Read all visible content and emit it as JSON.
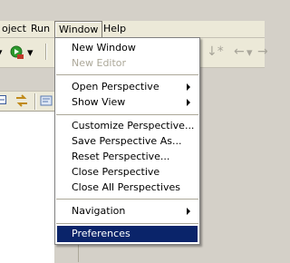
{
  "menubar": {
    "items": [
      {
        "label": "oject"
      },
      {
        "label": "Run"
      },
      {
        "label": "Window"
      },
      {
        "label": "Help"
      }
    ]
  },
  "window_menu": {
    "items": [
      {
        "label": "New Window",
        "enabled": true,
        "submenu": false
      },
      {
        "label": "New Editor",
        "enabled": false,
        "submenu": false
      },
      {
        "label": "Open Perspective",
        "enabled": true,
        "submenu": true
      },
      {
        "label": "Show View",
        "enabled": true,
        "submenu": true
      },
      {
        "label": "Customize Perspective...",
        "enabled": true,
        "submenu": false
      },
      {
        "label": "Save Perspective As...",
        "enabled": true,
        "submenu": false
      },
      {
        "label": "Reset Perspective...",
        "enabled": true,
        "submenu": false
      },
      {
        "label": "Close Perspective",
        "enabled": true,
        "submenu": false
      },
      {
        "label": "Close All Perspectives",
        "enabled": true,
        "submenu": false
      },
      {
        "label": "Navigation",
        "enabled": true,
        "submenu": true
      },
      {
        "label": "Preferences",
        "enabled": true,
        "submenu": false,
        "selected": true
      }
    ]
  },
  "colors": {
    "highlight": "#0a246a",
    "menu_background": "#ffffff",
    "chrome": "#ece9d8",
    "disabled_text": "#aca899"
  },
  "icons": [
    "run-icon",
    "dropdown-arrow-icon",
    "back-arrow-icon",
    "forward-arrow-icon",
    "collapse-icon",
    "link-editor-icon"
  ]
}
